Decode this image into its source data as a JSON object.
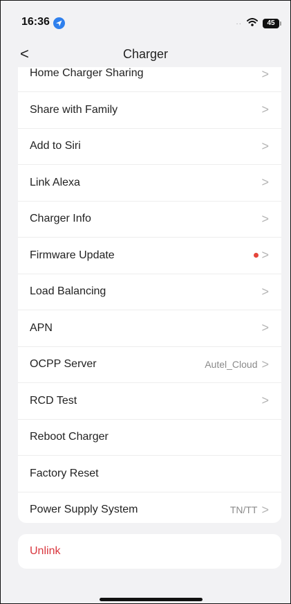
{
  "status_bar": {
    "time": "16:36",
    "battery": "45",
    "location_icon": "location-arrow-icon",
    "wifi_icon": "wifi-icon"
  },
  "nav": {
    "back_glyph": "<",
    "title": "Charger"
  },
  "menu": {
    "items": [
      {
        "label": "Home Charger Sharing",
        "value": "",
        "chevron": ">"
      },
      {
        "label": "Share with Family",
        "value": "",
        "chevron": ">"
      },
      {
        "label": "Add to Siri",
        "value": "",
        "chevron": ">"
      },
      {
        "label": "Link Alexa",
        "value": "",
        "chevron": ">"
      },
      {
        "label": "Charger Info",
        "value": "",
        "chevron": ">"
      },
      {
        "label": "Firmware Update",
        "value": "",
        "chevron": ">",
        "badge": "red-dot"
      },
      {
        "label": "Load Balancing",
        "value": "",
        "chevron": ">"
      },
      {
        "label": "APN",
        "value": "",
        "chevron": ">"
      },
      {
        "label": "OCPP Server",
        "value": "Autel_Cloud",
        "chevron": ">"
      },
      {
        "label": "RCD Test",
        "value": "",
        "chevron": ">"
      },
      {
        "label": "Reboot Charger",
        "value": "",
        "chevron": ""
      },
      {
        "label": "Factory Reset",
        "value": "",
        "chevron": ""
      },
      {
        "label": "Power Supply System",
        "value": "TN/TT",
        "chevron": ">"
      }
    ]
  },
  "unlink": {
    "label": "Unlink"
  },
  "colors": {
    "background": "#f2f2f4",
    "card": "#ffffff",
    "danger": "#d9363e",
    "badge": "#e5453b",
    "accent": "#2f80ed"
  }
}
